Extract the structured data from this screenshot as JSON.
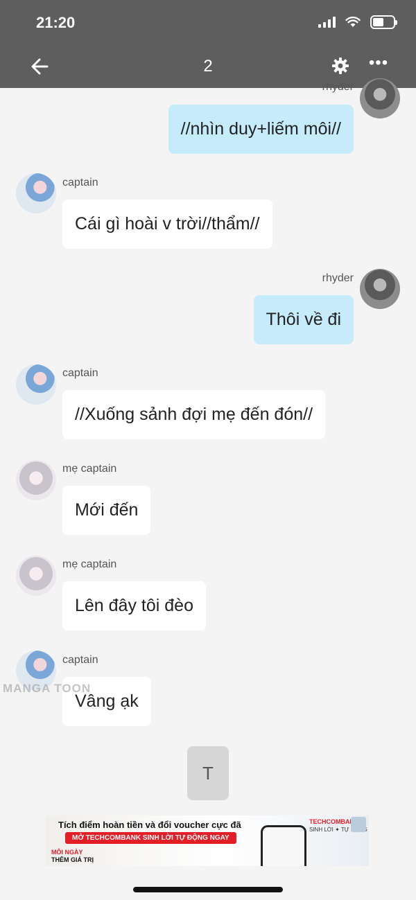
{
  "status_bar": {
    "time": "21:20"
  },
  "header": {
    "title": "2"
  },
  "messages": [
    {
      "sender": "rhyder",
      "text": "//nhìn duy+liếm môi//",
      "side": "right"
    },
    {
      "sender": "captain",
      "text": "Cái gì hoài v trời//thẩm//",
      "side": "left"
    },
    {
      "sender": "rhyder",
      "text": "Thôi về đi",
      "side": "right"
    },
    {
      "sender": "captain",
      "text": "//Xuống sảnh đợi mẹ đến đón//",
      "side": "left"
    },
    {
      "sender": "mẹ captain",
      "text": "Mới đến",
      "side": "left"
    },
    {
      "sender": "mẹ captain",
      "text": "Lên đây tôi đèo",
      "side": "left"
    },
    {
      "sender": "captain",
      "text": "Vâng ạk",
      "side": "left"
    }
  ],
  "watermark": "MANGA TOON",
  "input": {
    "type_button_label": "T"
  },
  "ad": {
    "title": "Tích điểm hoàn tiền và đổi voucher cực đã",
    "banner": "MỞ TECHCOMBANK SINH LỜI TỰ ĐỘNG NGAY",
    "tagline_1": "MỖI NGÀY",
    "tagline_2": "THÊM GIÁ TRỊ",
    "brand": "TECHCOMBANK",
    "brand_sub": "SINH LỜI ✦ TỰ ĐỘNG"
  },
  "colors": {
    "header_bg": "#5e5e5e",
    "own_bubble": "#c6ebfb",
    "other_bubble": "#ffffff",
    "background": "#f4f4f4"
  }
}
